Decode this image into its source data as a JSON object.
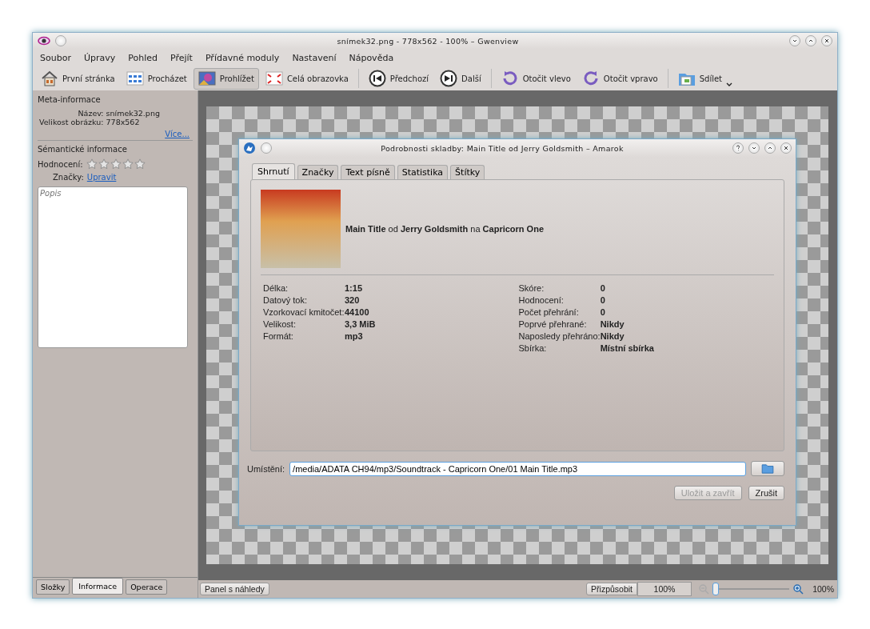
{
  "window": {
    "title": "snímek32.png - 778x562 - 100% – Gwenview"
  },
  "menu": [
    "Soubor",
    "Úpravy",
    "Pohled",
    "Přejít",
    "Přídavné moduly",
    "Nastavení",
    "Nápověda"
  ],
  "toolbar": [
    {
      "label": "První stránka",
      "selected": false
    },
    {
      "label": "Procházet",
      "selected": false
    },
    {
      "label": "Prohlížet",
      "selected": true
    },
    {
      "label": "Celá obrazovka",
      "selected": false
    },
    {
      "label": "Předchozí",
      "selected": false
    },
    {
      "label": "Další",
      "selected": false
    },
    {
      "label": "Otočit vlevo",
      "selected": false
    },
    {
      "label": "Otočit vpravo",
      "selected": false
    },
    {
      "label": "Sdílet",
      "selected": false
    }
  ],
  "sidebar": {
    "meta_heading": "Meta-informace",
    "meta_fields": [
      {
        "label": "Název:",
        "value": "snímek32.png"
      },
      {
        "label": "Velikost obrázku:",
        "value": "778x562"
      }
    ],
    "more_link": "Více...",
    "semantic_heading": "Sémantické informace",
    "rating_label": "Hodnocení:",
    "stars": 0,
    "tags_label": "Značky:",
    "tags_link": "Upravit",
    "description": {
      "placeholder": "Popis"
    },
    "tabs": [
      {
        "label": "Složky",
        "selected": false
      },
      {
        "label": "Informace",
        "selected": true
      },
      {
        "label": "Operace",
        "selected": false
      }
    ]
  },
  "dialog": {
    "title": "Podrobnosti skladby: Main Title od Jerry Goldsmith – Amarok",
    "tabs": [
      {
        "label": "Shrnutí",
        "selected": true
      },
      {
        "label": "Značky",
        "selected": false
      },
      {
        "label": "Text písně",
        "selected": false
      },
      {
        "label": "Statistika",
        "selected": false
      },
      {
        "label": "Štítky",
        "selected": false
      }
    ],
    "summary": "**Main Title** od **Jerry Goldsmith** na **Capricorn One**",
    "left_fields": [
      {
        "label": "Délka:",
        "value": "1:15"
      },
      {
        "label": "Datový tok:",
        "value": "320"
      },
      {
        "label": "Vzorkovací kmitočet:",
        "value": "44100"
      },
      {
        "label": "Velikost:",
        "value": "3,3 MiB"
      },
      {
        "label": "Formát:",
        "value": "mp3"
      }
    ],
    "right_fields": [
      {
        "label": "Skóre:",
        "value": "0"
      },
      {
        "label": "Hodnocení:",
        "value": "0"
      },
      {
        "label": "Počet přehrání:",
        "value": "0"
      },
      {
        "label": "Poprvé přehrané:",
        "value": "Nikdy"
      },
      {
        "label": "Naposledy přehráno:",
        "value": "Nikdy"
      },
      {
        "label": "Sbírka:",
        "value": "Místní sbírka"
      }
    ],
    "location": {
      "label": "Umístění:",
      "value": "/media/ADATA CH94/mp3/Soundtrack - Capricorn One/01 Main Title.mp3"
    },
    "buttons": [
      {
        "label": "Uložit a zavřít",
        "disabled": true
      },
      {
        "label": "Zrušit",
        "disabled": false
      }
    ]
  },
  "status_bar": {
    "thumbnail_button": "Panel s náhledy",
    "fit_button": "Přizpůsobit",
    "zoom_field": "100%",
    "zoom": {
      "level": 0
    },
    "zoom_reading": "100%"
  }
}
